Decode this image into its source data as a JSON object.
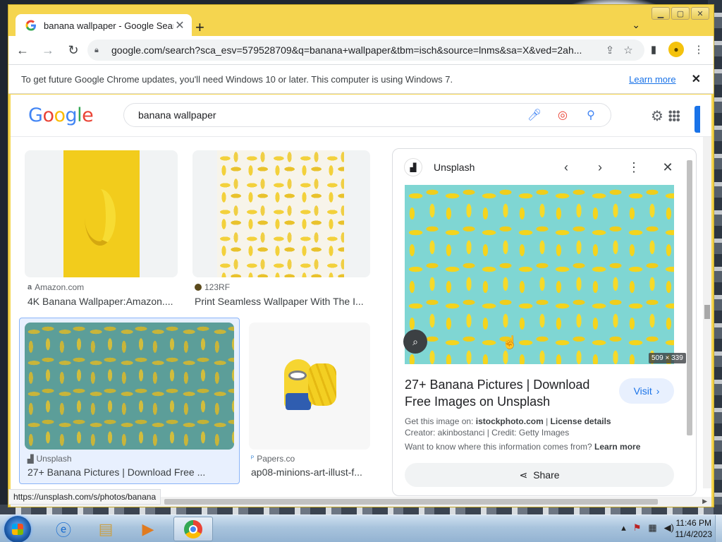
{
  "browser": {
    "tab_title": "banana wallpaper - Google Searc",
    "url_host": "google.com",
    "url_rest": "/search?sca_esv=579528709&q=banana+wallpaper&tbm=isch&source=lnms&sa=X&ved=2ah...",
    "infobar_message": "To get future Google Chrome updates, you'll need Windows 10 or later. This computer is using Windows 7.",
    "infobar_link": "Learn more",
    "status_url": "https://unsplash.com/s/photos/banana"
  },
  "search": {
    "logo": [
      "G",
      "o",
      "o",
      "g",
      "l",
      "e"
    ],
    "logo_colors": [
      "#4285f4",
      "#ea4335",
      "#fbbc05",
      "#4285f4",
      "#34a853",
      "#ea4335"
    ],
    "query": "banana wallpaper"
  },
  "results": [
    {
      "source": "Amazon.com",
      "title": "4K Banana Wallpaper:Amazon...."
    },
    {
      "source": "123RF",
      "title": "Print Seamless Wallpaper With The I..."
    },
    {
      "source": "Unsplash",
      "title": "27+ Banana Pictures | Download Free ..."
    },
    {
      "source": "Papers.co",
      "title": "ap08-minions-art-illust-f..."
    }
  ],
  "panel": {
    "source": "Unsplash",
    "dimensions": "509 × 339",
    "title": "27+ Banana Pictures | Download Free Images on Unsplash",
    "visit_label": "Visit",
    "get_image_prefix": "Get this image on:",
    "get_image_site": "istockphoto.com",
    "license": "License details",
    "creator_line": "Creator: akinbostanci | Credit: Getty Images",
    "info_question": "Want to know where this information comes from?",
    "learn_more": "Learn more",
    "share_label": "Share"
  },
  "taskbar": {
    "time": "11:46 PM",
    "date": "11/4/2023"
  }
}
